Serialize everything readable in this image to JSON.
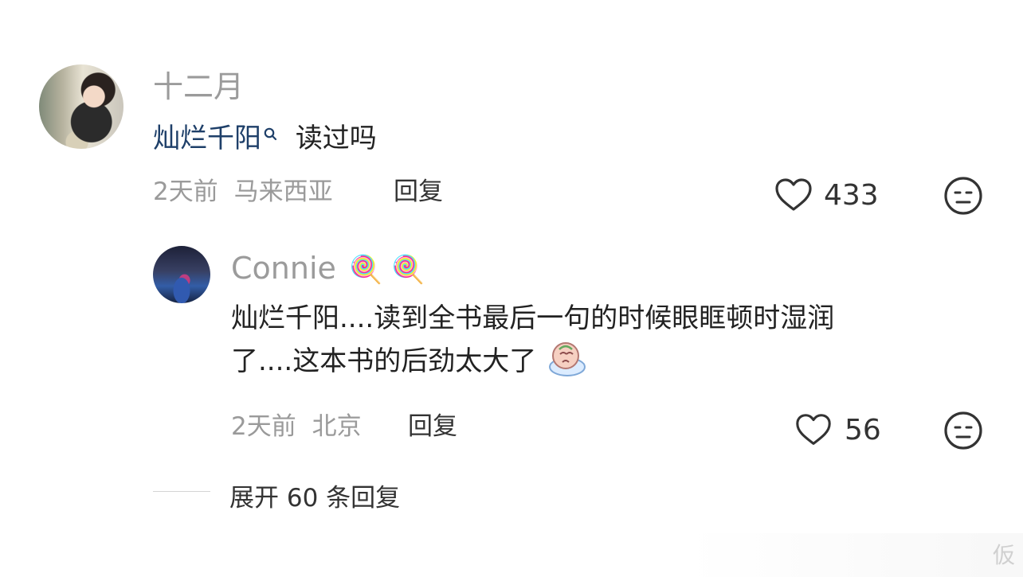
{
  "comments": [
    {
      "author": "十二月",
      "mention": "灿烂千阳",
      "mention_icon": "search-icon",
      "text": "读过吗",
      "time": "2天前",
      "location": "马来西亚",
      "reply_label": "回复",
      "likes": "433"
    },
    {
      "author": "Connie",
      "author_emojis": "🍭 🍭",
      "text_line1": "灿烂千阳....读到全书最后一句的时候眼眶顿时湿润",
      "text_line2": "了....这本书的后劲太大了",
      "text_emoji": "crying-face-icon",
      "time": "2天前",
      "location": "北京",
      "reply_label": "回复",
      "likes": "56"
    }
  ],
  "expand_label": "展开 60 条回复",
  "watermark_text": "仮"
}
